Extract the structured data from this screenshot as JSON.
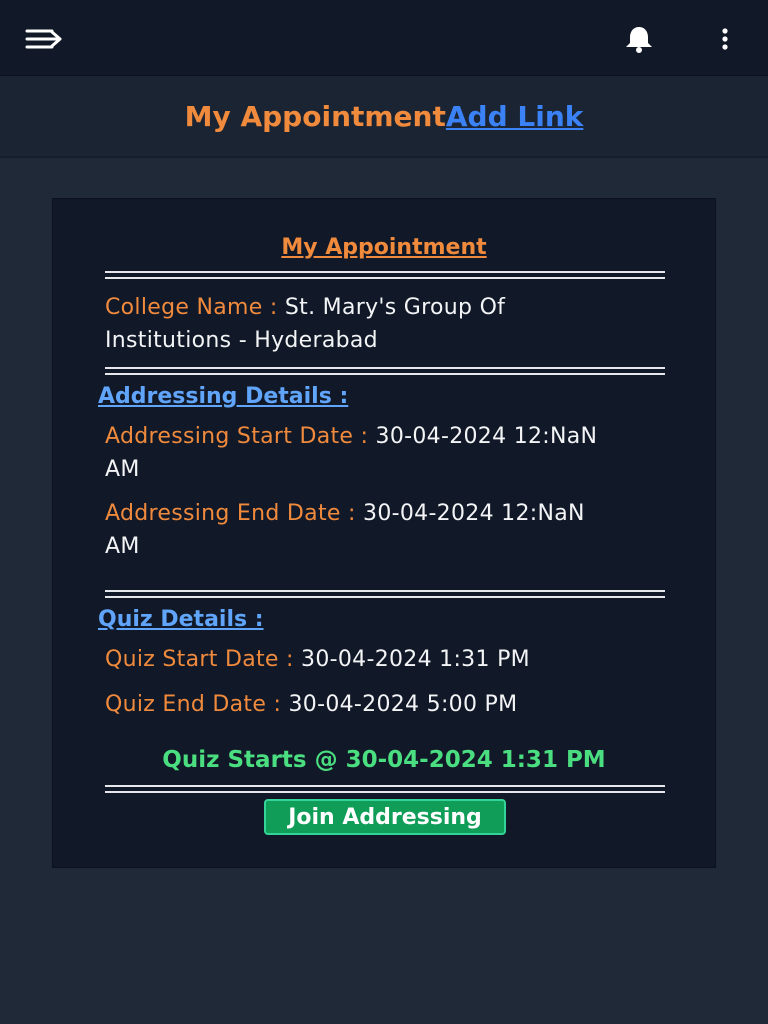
{
  "topbar": {
    "menu_icon": "menu-arrow-icon",
    "bell_icon": "bell-icon",
    "more_icon": "kebab-menu-icon"
  },
  "header": {
    "title": "My Appointment",
    "link": "Add Link"
  },
  "card": {
    "title": "My Appointment",
    "college_label": "College Name : ",
    "college_value": "St. Mary's Group Of Institutions - Hyderabad",
    "addressing_heading": "Addressing Details :",
    "addressing_start_label": "Addressing Start Date : ",
    "addressing_start_value": "30-04-2024 12:NaN AM",
    "addressing_end_label": "Addressing End Date : ",
    "addressing_end_value": "30-04-2024 12:NaN AM",
    "quiz_heading": "Quiz Details :",
    "quiz_start_label": "Quiz Start Date : ",
    "quiz_start_value": "30-04-2024 1:31 PM",
    "quiz_end_label": "Quiz End Date : ",
    "quiz_end_value": "30-04-2024 5:00 PM",
    "quiz_starts": "Quiz Starts @ 30-04-2024 1:31 PM",
    "join_button": "Join Addressing"
  },
  "colors": {
    "accent_orange": "#f08a3c",
    "link_blue": "#3b82f6",
    "success_green": "#4ade80",
    "button_green": "#0f9d58"
  }
}
